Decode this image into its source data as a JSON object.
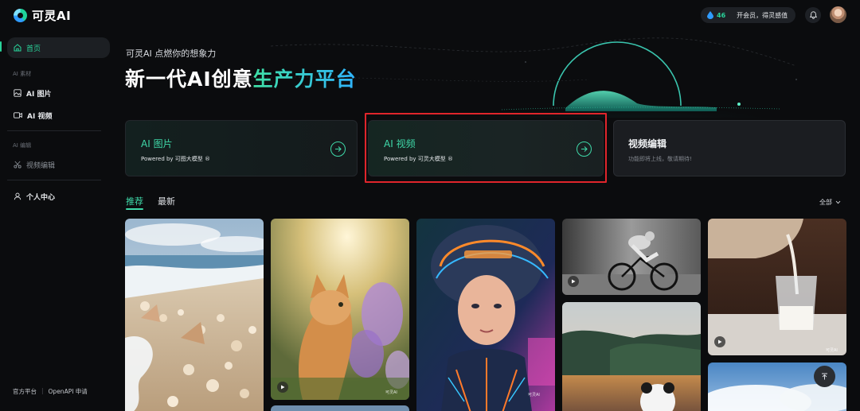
{
  "app": {
    "logo_text": "可灵AI"
  },
  "topbar": {
    "credits": "46",
    "member_label": "开会员，得灵感值"
  },
  "sidebar": {
    "home": "首页",
    "section_material": "AI 素材",
    "ai_image": "AI 图片",
    "ai_video": "AI 视频",
    "section_edit": "AI 编辑",
    "video_edit": "视频编辑",
    "personal": "个人中心",
    "footer_official": "官方平台",
    "footer_sep": "|",
    "footer_openapi": "OpenAPI 申请"
  },
  "hero": {
    "subtitle": "可灵AI 点燃你的想象力",
    "title_part1": "新一代AI创意",
    "title_part2": "生产力平台"
  },
  "cards": {
    "image": {
      "title": "AI 图片",
      "desc": "Powered by 可图大模型 ®"
    },
    "video": {
      "title": "AI 视频",
      "desc": "Powered by 可灵大模型 ®"
    },
    "edit": {
      "title": "视频编辑",
      "desc": "功能即将上线，敬请期待!"
    }
  },
  "tabs": {
    "recommend": "推荐",
    "latest": "最新"
  },
  "filter": {
    "label": "全部"
  },
  "gallery": {
    "watermark": "可灵AI"
  },
  "colors": {
    "accent": "#29d39a",
    "highlight": "#e0252b",
    "background": "#0b0c0e"
  },
  "icons": [
    "logo-icon",
    "drop-icon",
    "bell-icon",
    "home-icon",
    "image-icon",
    "video-icon",
    "scissors-icon",
    "user-icon",
    "arrow-right-icon",
    "chevron-down-icon",
    "play-icon",
    "arrow-up-icon"
  ]
}
